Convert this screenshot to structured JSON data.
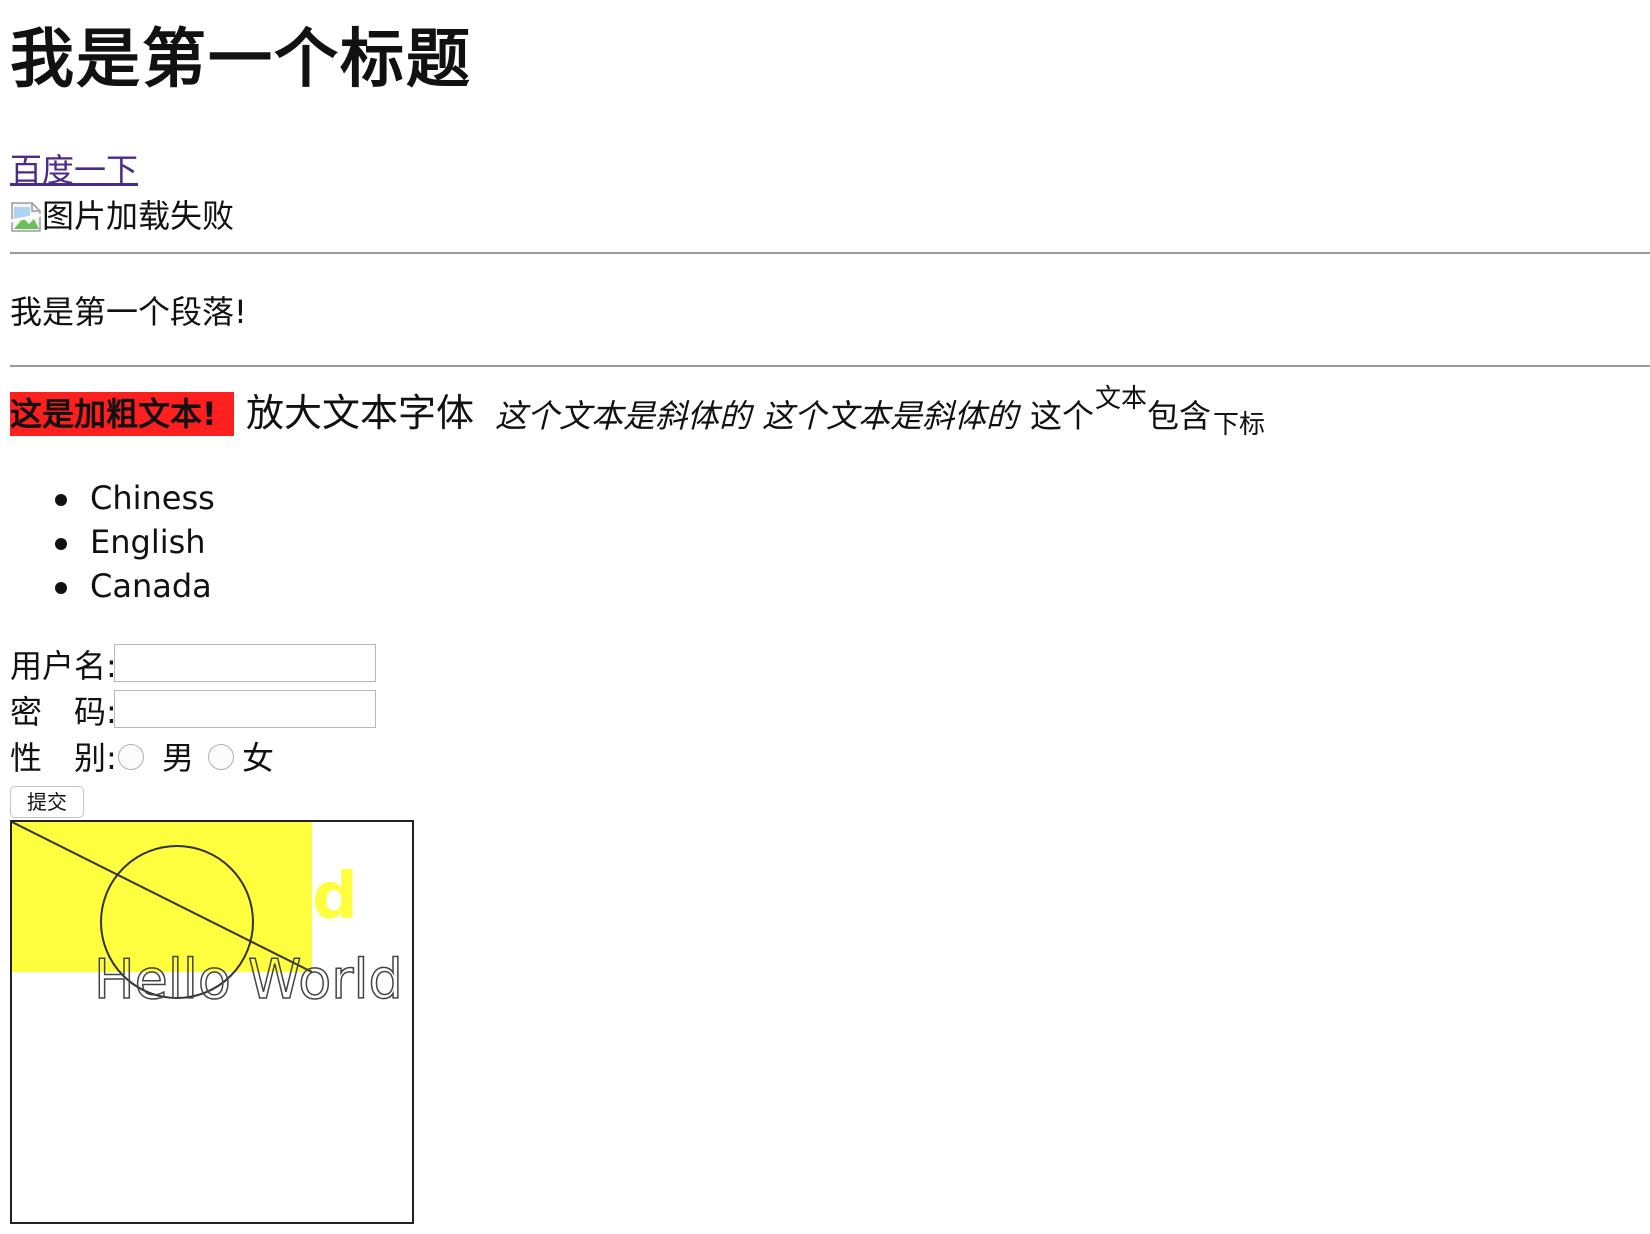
{
  "heading": "我是第一个标题",
  "link_text": "百度一下",
  "image_alt": "图片加载失败",
  "paragraph": "我是第一个段落!",
  "formatting": {
    "bold": "这是加粗文本!",
    "big": "放大文本字体",
    "italic_1": "这个文本是斜体的",
    "italic_2": "这个文本是斜体的",
    "plain_1": "这个",
    "superscript": "文本",
    "plain_2": "包含",
    "subscript": "下标",
    "highlight_color": "#fe1f1f"
  },
  "list_items": [
    "Chiness",
    "English",
    "Canada"
  ],
  "form": {
    "username_label": "用户名:",
    "username_value": "",
    "password_label_1": "密",
    "password_label_2": "码:",
    "password_value": "",
    "gender_label_1": "性",
    "gender_label_2": "别:",
    "option_male": "男",
    "option_female": "女",
    "submit_label": "提交"
  },
  "canvas": {
    "fill_color": "#ffff40",
    "faint_text": "d",
    "outline_text": "Hello World"
  }
}
